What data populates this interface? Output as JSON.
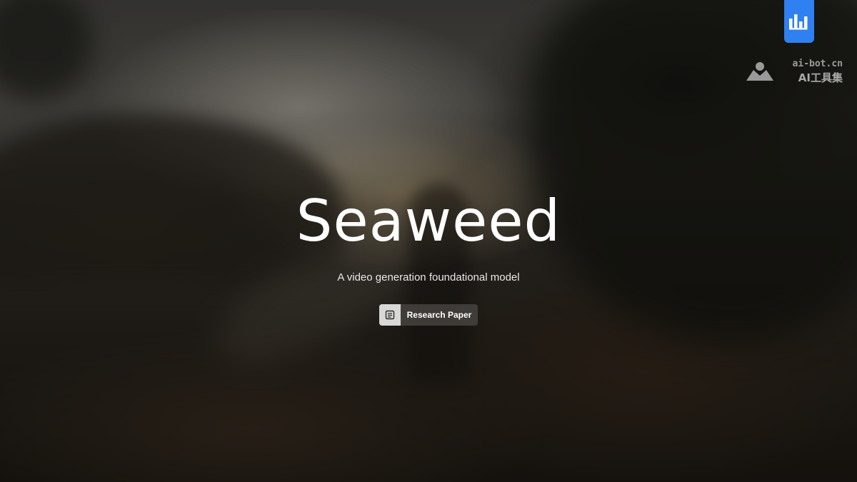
{
  "hero": {
    "title": "Seaweed",
    "subtitle": "A video generation foundational model",
    "paper_button_label": "Research Paper",
    "paper_button_icon": "document-icon"
  },
  "watermark": {
    "domain": "ai-bot.cn",
    "name": "AI工具集",
    "logo_icon": "ai-bot-logo-icon",
    "badge_icon": "bar-chart-icon",
    "badge_color": "#2f80f0"
  },
  "colors": {
    "text": "#ffffff",
    "button_bg": "#484642",
    "button_icon_bg": "#d8d8d6"
  }
}
